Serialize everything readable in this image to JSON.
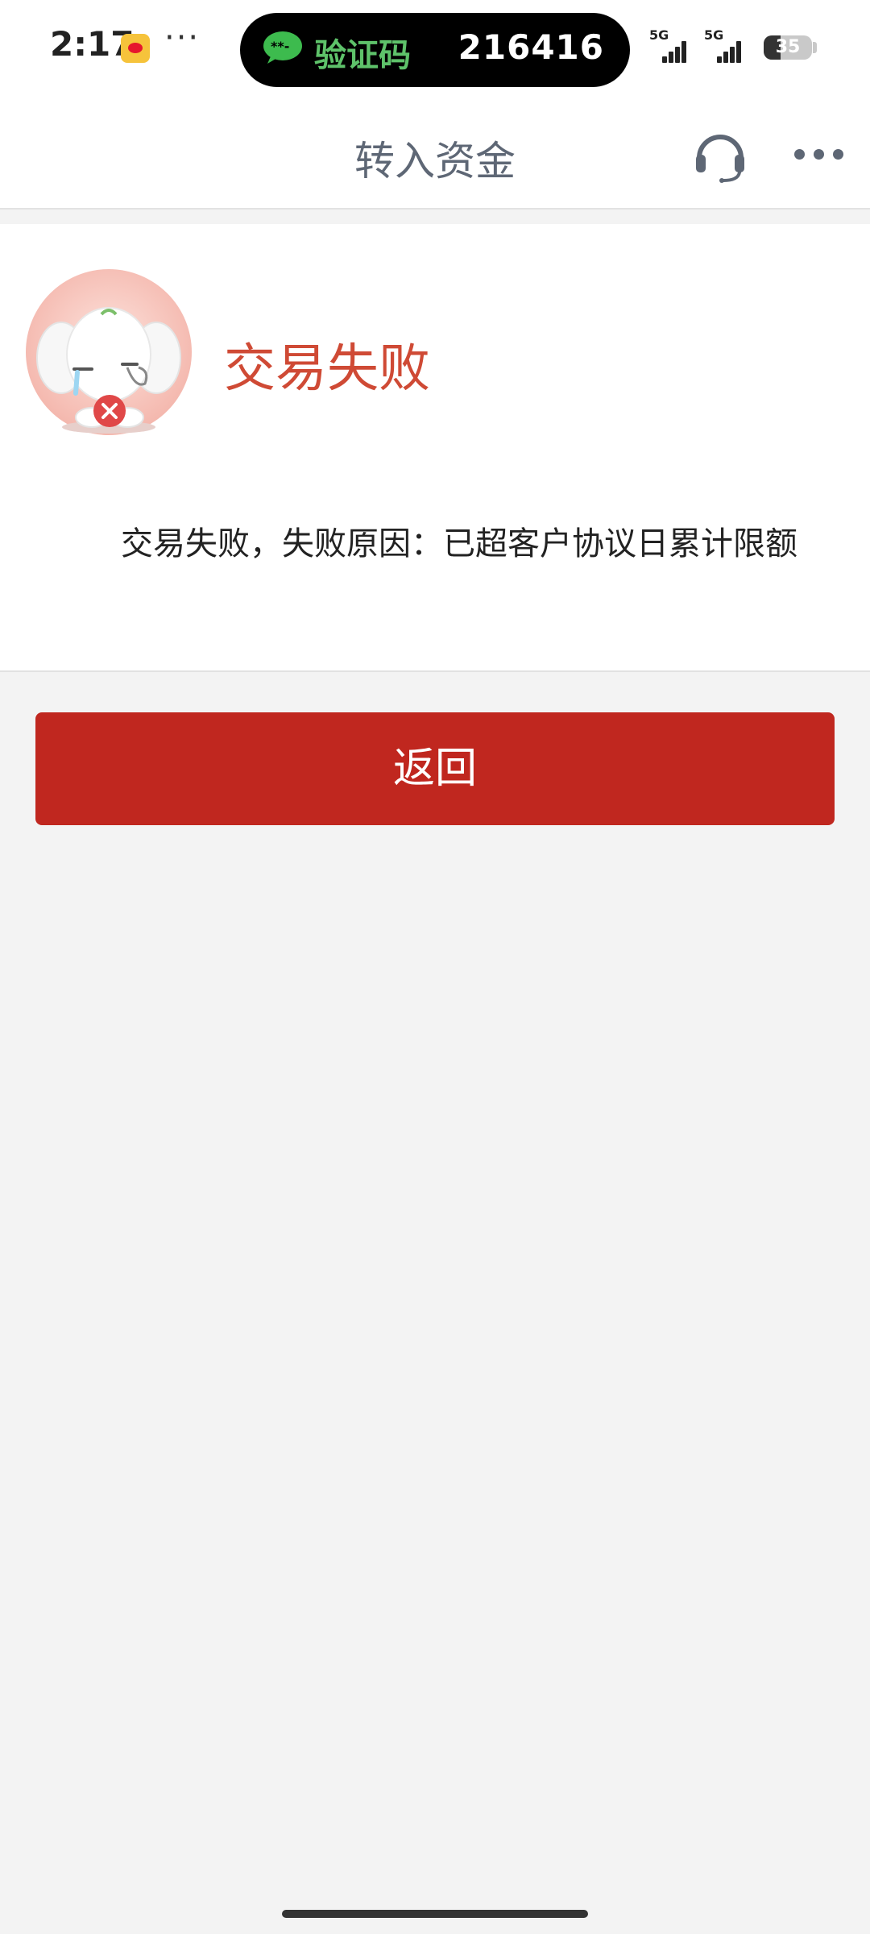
{
  "status_bar": {
    "time": "2:17",
    "overflow_dots": "···",
    "sms_notification": {
      "label": "验证码",
      "code": "216416",
      "label_color": "#5ec26a"
    },
    "networks": [
      "5G",
      "5G"
    ],
    "battery_level": "35"
  },
  "nav": {
    "title": "转入资金"
  },
  "result": {
    "title": "交易失败",
    "title_color": "#cf4a35",
    "message": "交易失败，失败原因：已超客户协议日累计限额"
  },
  "actions": {
    "back_label": "返回",
    "button_color": "#c0271f"
  },
  "icons": {
    "weibo": "weibo-icon",
    "sms": "message-icon",
    "headset": "customer-service-icon",
    "more": "more-dots-icon",
    "mascot": "crying-elephant-error-icon"
  }
}
